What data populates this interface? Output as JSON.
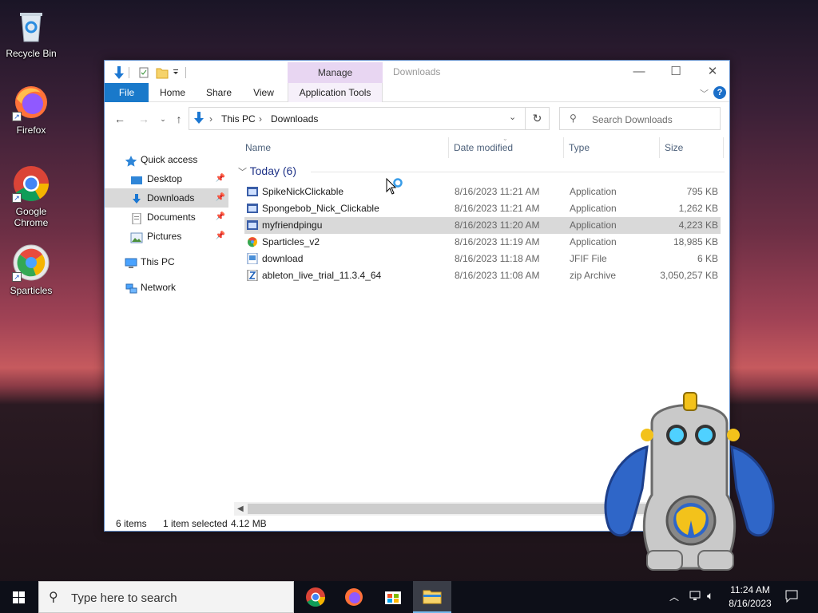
{
  "desktop": {
    "icons": [
      {
        "label": "Recycle Bin"
      },
      {
        "label": "Firefox"
      },
      {
        "label": "Google Chrome"
      },
      {
        "label": "Sparticles"
      }
    ]
  },
  "window": {
    "title": "Downloads",
    "contextual_tab": "Manage",
    "ribbon_tabs": {
      "file": "File",
      "home": "Home",
      "share": "Share",
      "view": "View",
      "app_tools": "Application Tools"
    },
    "address": {
      "root": "This PC",
      "folder": "Downloads"
    },
    "search_placeholder": "Search Downloads",
    "nav": {
      "quick_access": "Quick access",
      "desktop": "Desktop",
      "downloads": "Downloads",
      "documents": "Documents",
      "pictures": "Pictures",
      "this_pc": "This PC",
      "network": "Network"
    },
    "columns": {
      "name": "Name",
      "date": "Date modified",
      "type": "Type",
      "size": "Size"
    },
    "group": "Today (6)",
    "files": [
      {
        "name": "SpikeNickClickable",
        "date": "8/16/2023 11:21 AM",
        "type": "Application",
        "size": "795 KB",
        "icon": "app-icon"
      },
      {
        "name": "Spongebob_Nick_Clickable",
        "date": "8/16/2023 11:21 AM",
        "type": "Application",
        "size": "1,262 KB",
        "icon": "app-icon"
      },
      {
        "name": "myfriendpingu",
        "date": "8/16/2023 11:20 AM",
        "type": "Application",
        "size": "4,223 KB",
        "icon": "app-icon"
      },
      {
        "name": "Sparticles_v2",
        "date": "8/16/2023 11:19 AM",
        "type": "Application",
        "size": "18,985 KB",
        "icon": "sparticles-icon"
      },
      {
        "name": "download",
        "date": "8/16/2023 11:18 AM",
        "type": "JFIF File",
        "size": "6 KB",
        "icon": "image-file-icon"
      },
      {
        "name": "ableton_live_trial_11.3.4_64",
        "date": "8/16/2023 11:08 AM",
        "type": "zip Archive",
        "size": "3,050,257 KB",
        "icon": "zip-icon"
      }
    ],
    "status": {
      "count": "6 items",
      "selected": "1 item selected",
      "size": "4.12 MB"
    }
  },
  "taskbar": {
    "search_placeholder": "Type here to search",
    "time": "11:24 AM",
    "date": "8/16/2023"
  },
  "colors": {
    "accent": "#1979ca",
    "manage_tab": "#e8d6f2",
    "selection": "#d9d9d9",
    "group_header": "#1e3287"
  }
}
